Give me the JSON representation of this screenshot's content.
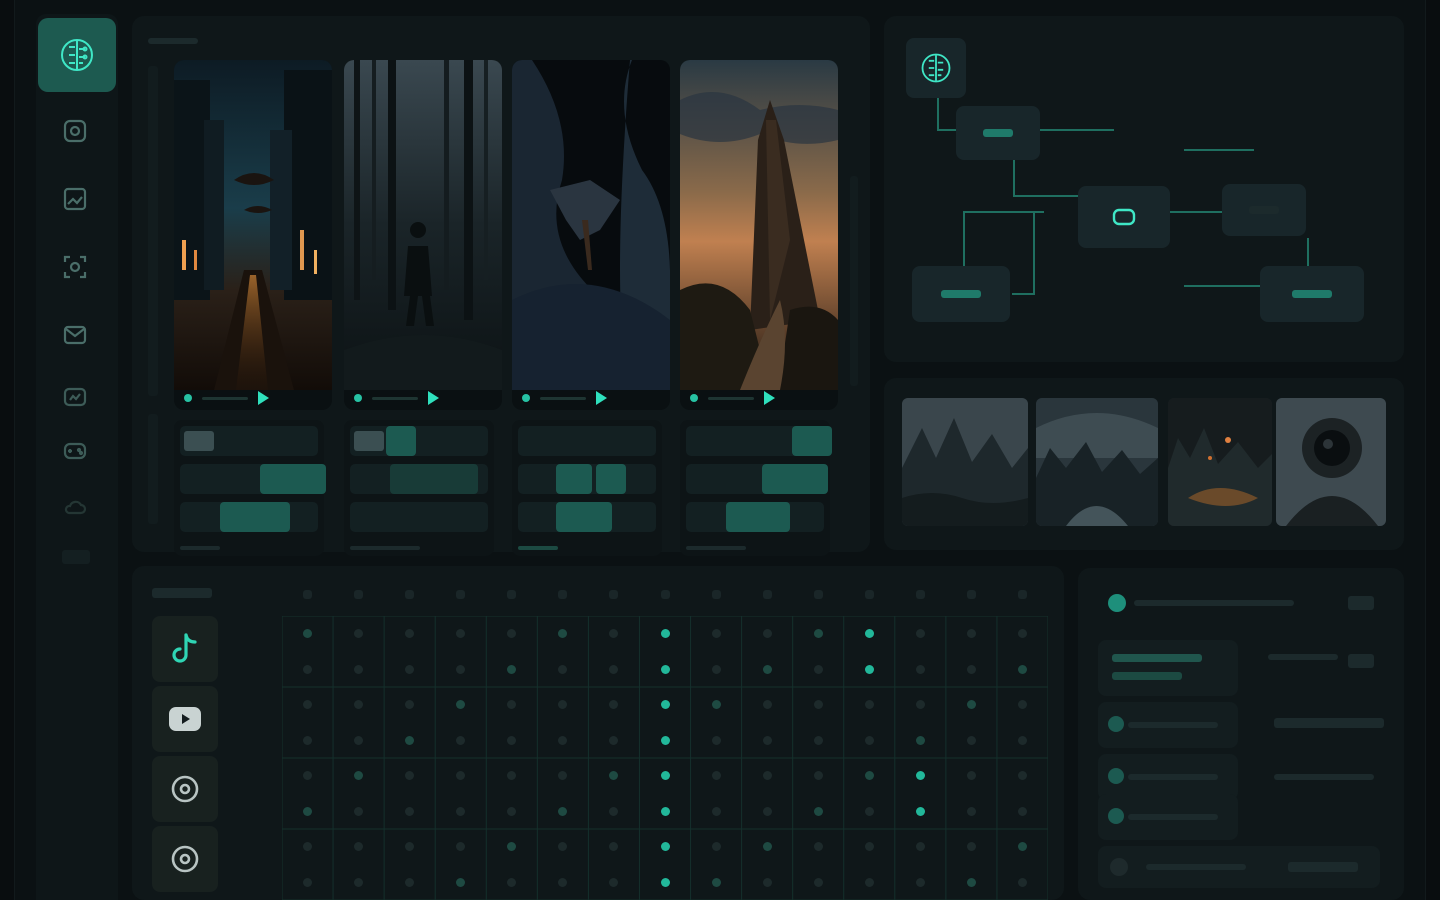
{
  "app": {
    "brand_icon": "brain-circuit-icon"
  },
  "sidebar": {
    "items": [
      {
        "icon": "chat-square-icon"
      },
      {
        "icon": "image-frame-icon"
      },
      {
        "icon": "scan-face-icon"
      },
      {
        "icon": "mail-icon"
      },
      {
        "icon": "media-box-icon"
      },
      {
        "icon": "gamepad-icon"
      },
      {
        "icon": "cloud-icon"
      }
    ]
  },
  "gallery": {
    "cards": [
      {
        "scene": "neon-city-street-night",
        "track_chips": 3
      },
      {
        "scene": "dark-forest-figure",
        "track_chips": 2
      },
      {
        "scene": "space-rock-fragment",
        "track_chips": 4
      },
      {
        "scene": "sunset-rock-spire",
        "track_chips": 3
      }
    ]
  },
  "flow": {
    "icon": "brain-circuit-icon",
    "nodes": 6
  },
  "thumbs": [
    {
      "scene": "misty-mountain-lake"
    },
    {
      "scene": "stormy-rocky-shore"
    },
    {
      "scene": "ember-ruins"
    },
    {
      "scene": "astronaut-helmet"
    }
  ],
  "matrix": {
    "platforms": [
      {
        "icon": "tiktok-icon"
      },
      {
        "icon": "youtube-icon"
      },
      {
        "icon": "threads-icon"
      },
      {
        "icon": "threads-icon"
      }
    ],
    "columns": 15,
    "active": [
      [
        7,
        11
      ],
      [
        7,
        11
      ],
      [
        7
      ],
      [
        7
      ],
      [
        7,
        12
      ],
      [
        7,
        12
      ],
      [
        7
      ],
      [
        7
      ]
    ]
  },
  "colors": {
    "accent": "#27c2a4",
    "accent_dim": "#1d5a50",
    "bg": "#0b1113",
    "panel": "#0f1719"
  }
}
